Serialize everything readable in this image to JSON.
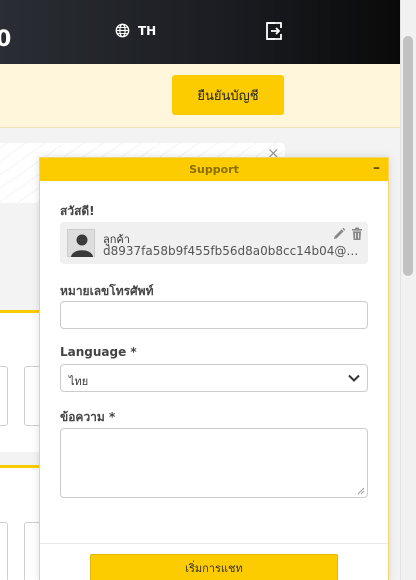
{
  "header": {
    "logo_fragment": "0",
    "language_code": "TH",
    "globe_icon": "globe-icon",
    "logout_icon": "logout-icon"
  },
  "banner": {
    "verify_label": "ยืนยันบัญชี"
  },
  "notice": {
    "close_label": "×"
  },
  "widget": {
    "title": "Support",
    "minimize_label": "–",
    "greeting": "สวัสดี!",
    "visitor": {
      "name": "ลูกค้า",
      "email": "d8937fa58b9f455fb56d8a0b8cc14b04@e..."
    },
    "phone": {
      "label": "หมายเลขโทรศัพท์",
      "value": ""
    },
    "language": {
      "label": "Language *",
      "selected": "ไทย"
    },
    "message": {
      "label": "ข้อความ *",
      "value": ""
    },
    "start_label": "เริ่มการแชท"
  },
  "colors": {
    "accent": "#fccc00",
    "banner_bg": "#fff6db",
    "header_dark": "#1b1d22"
  }
}
